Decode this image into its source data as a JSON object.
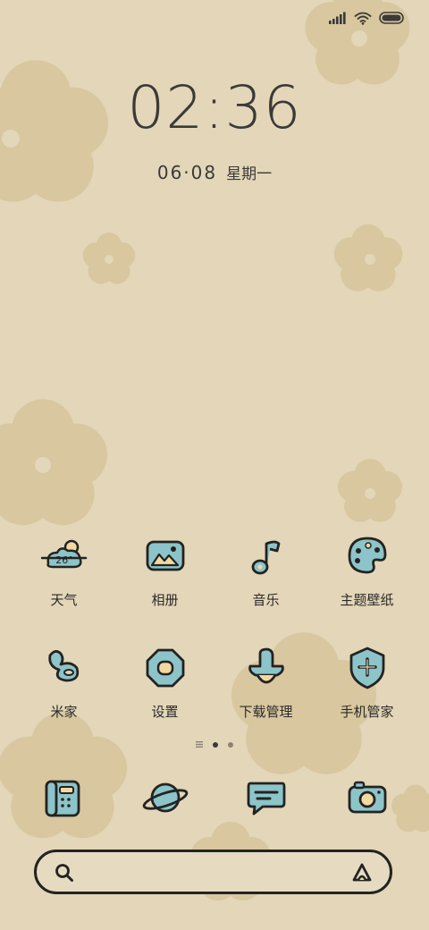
{
  "status_bar": {
    "icons": [
      "signal-icon",
      "wifi-icon",
      "battery-icon"
    ]
  },
  "clock": {
    "time": "02:36"
  },
  "date": {
    "date": "06·08",
    "weekday": "星期一"
  },
  "apps_row1": [
    {
      "label": "天气",
      "icon": "weather-icon",
      "temp": "26°"
    },
    {
      "label": "相册",
      "icon": "gallery-icon"
    },
    {
      "label": "音乐",
      "icon": "music-icon"
    },
    {
      "label": "主题壁纸",
      "icon": "themes-icon"
    }
  ],
  "apps_row2": [
    {
      "label": "米家",
      "icon": "mi-home-icon"
    },
    {
      "label": "设置",
      "icon": "settings-icon"
    },
    {
      "label": "下载管理",
      "icon": "download-icon"
    },
    {
      "label": "手机管家",
      "icon": "security-icon"
    }
  ],
  "page_indicator": {
    "pages": 3,
    "current": 1
  },
  "dock": [
    {
      "icon": "phone-icon"
    },
    {
      "icon": "browser-icon"
    },
    {
      "icon": "messages-icon"
    },
    {
      "icon": "camera-icon"
    }
  ],
  "search_bar": {
    "icons": [
      "search-icon",
      "assistant-icon"
    ]
  },
  "colors": {
    "background": "#e3d6b9",
    "flower": "#d8c79f",
    "icon_fill": "#8cc4c9",
    "ink": "#232321"
  }
}
